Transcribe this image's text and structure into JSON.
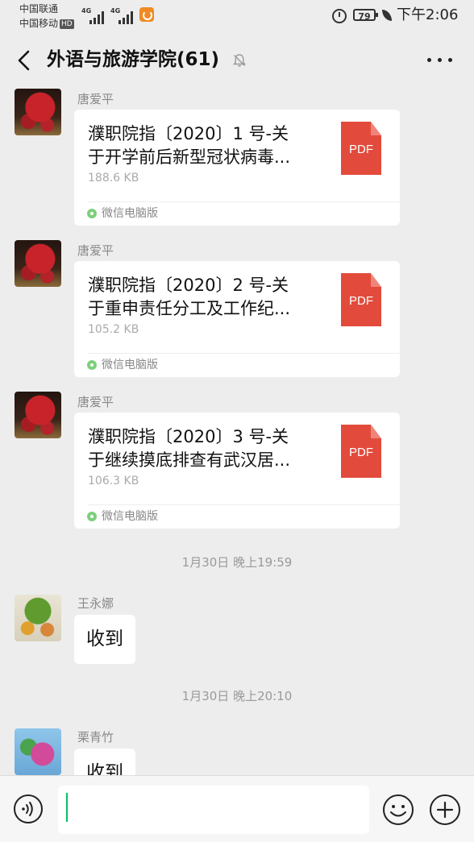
{
  "status_bar": {
    "carrier1": "中国联通",
    "carrier2": "中国移动",
    "hd_badge": "HD",
    "signal1_tag": "4G",
    "signal2_tag": "4G",
    "battery_level": "79",
    "time": "下午2:06"
  },
  "header": {
    "title": "外语与旅游学院(61)",
    "back_icon": "back-chevron-icon",
    "mute_icon": "bell-off-icon",
    "more_icon": "more-dots-icon"
  },
  "messages": [
    {
      "sender": "唐爱平",
      "file_name_line1": "濮职院指〔2020〕1 号-关",
      "file_name_line2": "于开学前后新型冠状病毒...",
      "file_size": "188.6 KB",
      "file_type": "PDF",
      "source": "微信电脑版"
    },
    {
      "sender": "唐爱平",
      "file_name_line1": "濮职院指〔2020〕2 号-关",
      "file_name_line2": "于重申责任分工及工作纪...",
      "file_size": "105.2 KB",
      "file_type": "PDF",
      "source": "微信电脑版"
    },
    {
      "sender": "唐爱平",
      "file_name_line1": "濮职院指〔2020〕3 号-关",
      "file_name_line2": "于继续摸底排查有武汉居...",
      "file_size": "106.3 KB",
      "file_type": "PDF",
      "source": "微信电脑版"
    }
  ],
  "timestamps": [
    "1月30日 晚上19:59",
    "1月30日 晚上20:10"
  ],
  "text_messages": [
    {
      "sender": "王永娜",
      "text": "收到"
    },
    {
      "sender": "栗青竹",
      "text": "收到"
    }
  ],
  "input_bar": {
    "value": "",
    "voice_icon": "voice-icon",
    "emoji_icon": "emoji-icon",
    "plus_icon": "plus-icon"
  },
  "colors": {
    "background": "#ededed",
    "bubble": "#ffffff",
    "pdf": "#e24b3c",
    "accent": "#07c160"
  }
}
